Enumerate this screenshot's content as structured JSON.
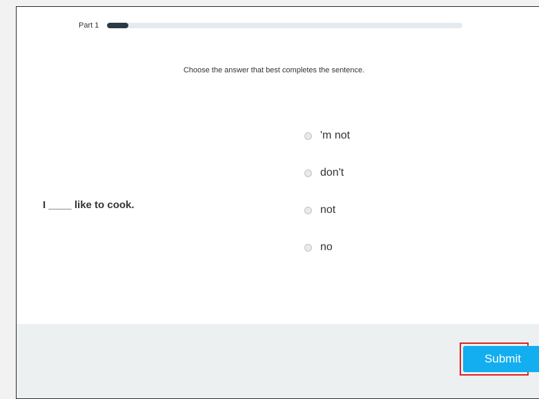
{
  "progress": {
    "part_label": "Part 1",
    "fraction": 0.06
  },
  "instruction": "Choose the answer that best completes the sentence.",
  "question": {
    "text": "I ____ like to cook."
  },
  "options": [
    {
      "label": "'m not"
    },
    {
      "label": "don't"
    },
    {
      "label": "not"
    },
    {
      "label": "no"
    }
  ],
  "footer": {
    "submit_label": "Submit"
  },
  "colors": {
    "progress_fill": "#2c3a46",
    "progress_track": "#e3ebf1",
    "submit_bg": "#12aef0",
    "highlight_outline": "#e0201e",
    "footer_bg": "#ecf0f1"
  }
}
